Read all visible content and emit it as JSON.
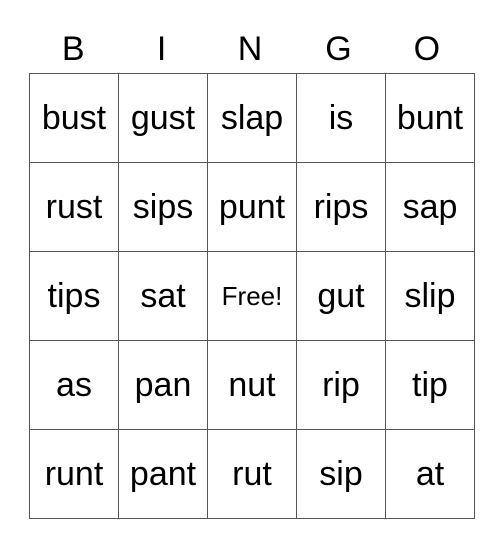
{
  "card": {
    "header": [
      "B",
      "I",
      "N",
      "G",
      "O"
    ],
    "rows": [
      [
        "bust",
        "gust",
        "slap",
        "is",
        "bunt"
      ],
      [
        "rust",
        "sips",
        "punt",
        "rips",
        "sap"
      ],
      [
        "tips",
        "sat",
        "Free!",
        "gut",
        "slip"
      ],
      [
        "as",
        "pan",
        "nut",
        "rip",
        "tip"
      ],
      [
        "runt",
        "pant",
        "rut",
        "sip",
        "at"
      ]
    ]
  }
}
